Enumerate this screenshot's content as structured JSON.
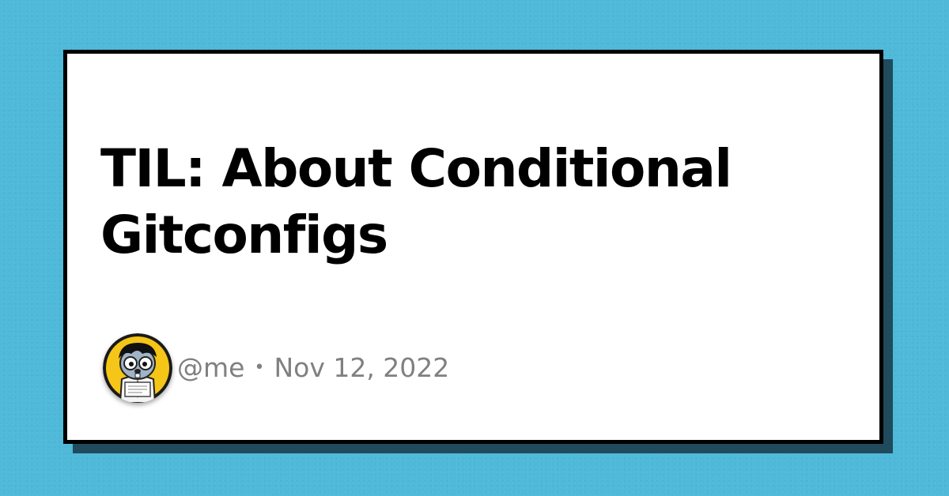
{
  "post": {
    "title": "TIL: About Conditional Gitconfigs",
    "author": "@me",
    "separator": "•",
    "date": "Nov 12, 2022"
  },
  "colors": {
    "background": "#4fb9d9",
    "card": "#ffffff",
    "card_border": "#000000",
    "card_shadow": "#1f4b5c",
    "title": "#000000",
    "meta_text": "#808080",
    "avatar_ring": "#f5c518"
  },
  "icons": {
    "avatar": "gopher-avatar-icon"
  }
}
